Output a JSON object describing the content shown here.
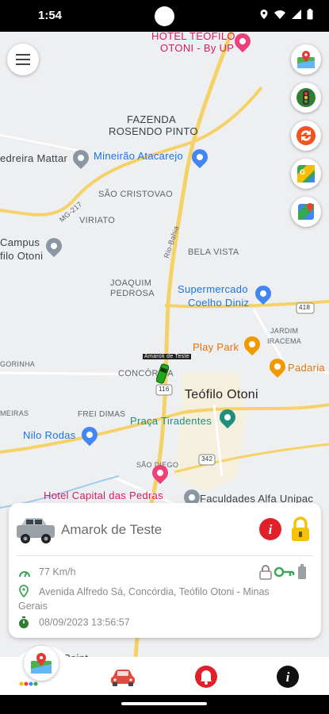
{
  "status_bar": {
    "time": "1:54"
  },
  "map": {
    "labels": {
      "hotel_top": "HOTEL TEÓFILO",
      "hotel_top2": "OTONI - By UP",
      "fazenda": "FAZENDA",
      "fazenda2": "ROSENDO PINTO",
      "pedreira": "edreira Mattar",
      "mineirao": "Mineirão Atacarejo",
      "sao_cristovao": "SÃO CRISTOVAO",
      "viriato": "VIRIATO",
      "mg217": "MG-217",
      "campus": "Campus",
      "campus2": "filo Otoni",
      "rio_bahia": "Rio-Bahia",
      "bela_vista": "BELA VISTA",
      "joaquim": "JOAQUIM",
      "joaquim2": "PEDROSA",
      "supermercado": "Supermercado",
      "supermercado2": "Coelho Diniz",
      "route418": "418",
      "jardim": "JARDIM",
      "jardim2": "IRACEMA",
      "play_park": "Play Park",
      "padaria": "Padaria",
      "gorinha": "GORINHA",
      "concordia": "CONCÓRDIA",
      "route116": "116",
      "teofilo": "Teófilo Otoni",
      "meiras": "MEIRAS",
      "frei_dimas": "FREI DIMAS",
      "praca": "Praça Tiradentes",
      "nilo": "Nilo Rodas",
      "sao_diego": "SÃO DIEGO",
      "route342": "342",
      "hotel_capital": "Hotel Capital das Pedras",
      "faculdades": "Faculdades Alfa Unipac",
      "point": "Point",
      "vehicle_tag": "Amarok de Teste"
    }
  },
  "vehicle_card": {
    "name": "Amarok de Teste",
    "speed": "77 Km/h",
    "address": "Avenida Alfredo Sá, Concórdia, Teófilo Otoni - Minas",
    "address2": "Gerais",
    "datetime": "08/09/2023 13:56:57"
  },
  "colors": {
    "primary_red": "#e0202a",
    "accent_yellow": "#f4c20d",
    "status_green": "#3aa757"
  },
  "icons": {
    "menu": "hamburger-icon",
    "side": [
      "map-pin-icon",
      "traffic-light-icon",
      "refresh-icon",
      "google-maps-icon",
      "google-maps-alt-icon"
    ],
    "nav": [
      "map-icon",
      "car-icon",
      "bell-icon",
      "info-icon"
    ]
  }
}
